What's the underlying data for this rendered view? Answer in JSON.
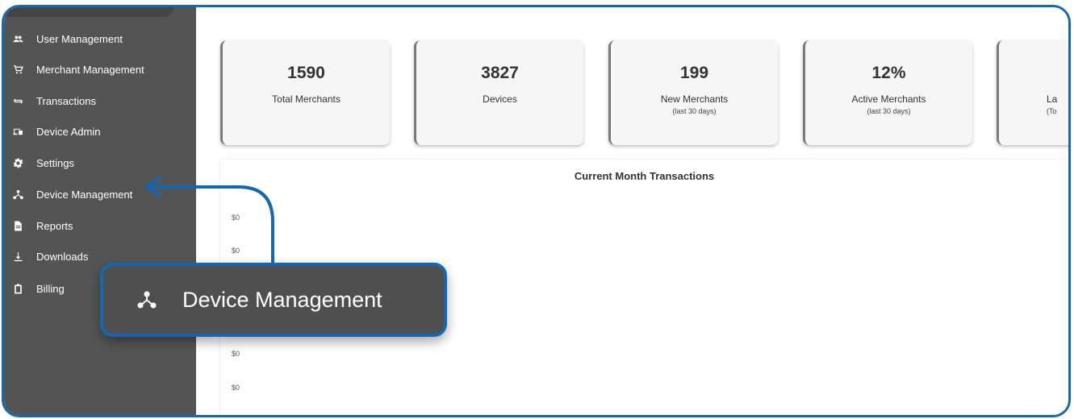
{
  "sidebar": {
    "items": [
      {
        "label": "User Management",
        "icon": "people-icon"
      },
      {
        "label": "Merchant Management",
        "icon": "cart-icon"
      },
      {
        "label": "Transactions",
        "icon": "swap-arrows-icon"
      },
      {
        "label": "Device Admin",
        "icon": "devices-icon"
      },
      {
        "label": "Settings",
        "icon": "gear-icon"
      },
      {
        "label": "Device Management",
        "icon": "hub-icon"
      },
      {
        "label": "Reports",
        "icon": "document-icon"
      },
      {
        "label": "Downloads",
        "icon": "download-icon"
      },
      {
        "label": "Billing",
        "icon": "clipboard-icon"
      }
    ]
  },
  "stats": [
    {
      "value": "1590",
      "label": "Total Merchants",
      "sublabel": ""
    },
    {
      "value": "3827",
      "label": "Devices",
      "sublabel": ""
    },
    {
      "value": "199",
      "label": "New Merchants",
      "sublabel": "(last 30 days)"
    },
    {
      "value": "12%",
      "label": "Active Merchants",
      "sublabel": "(last 30 days)"
    },
    {
      "value": "",
      "label": "La",
      "sublabel": "(To"
    }
  ],
  "chart": {
    "title": "Current Month Transactions",
    "y_ticks": [
      "$0",
      "$0",
      "$0",
      "$0",
      "$0",
      "$0"
    ]
  },
  "callout": {
    "label": "Device Management",
    "icon": "hub-icon"
  },
  "colors": {
    "accent": "#1467b0",
    "sidebar_bg": "#545454"
  }
}
